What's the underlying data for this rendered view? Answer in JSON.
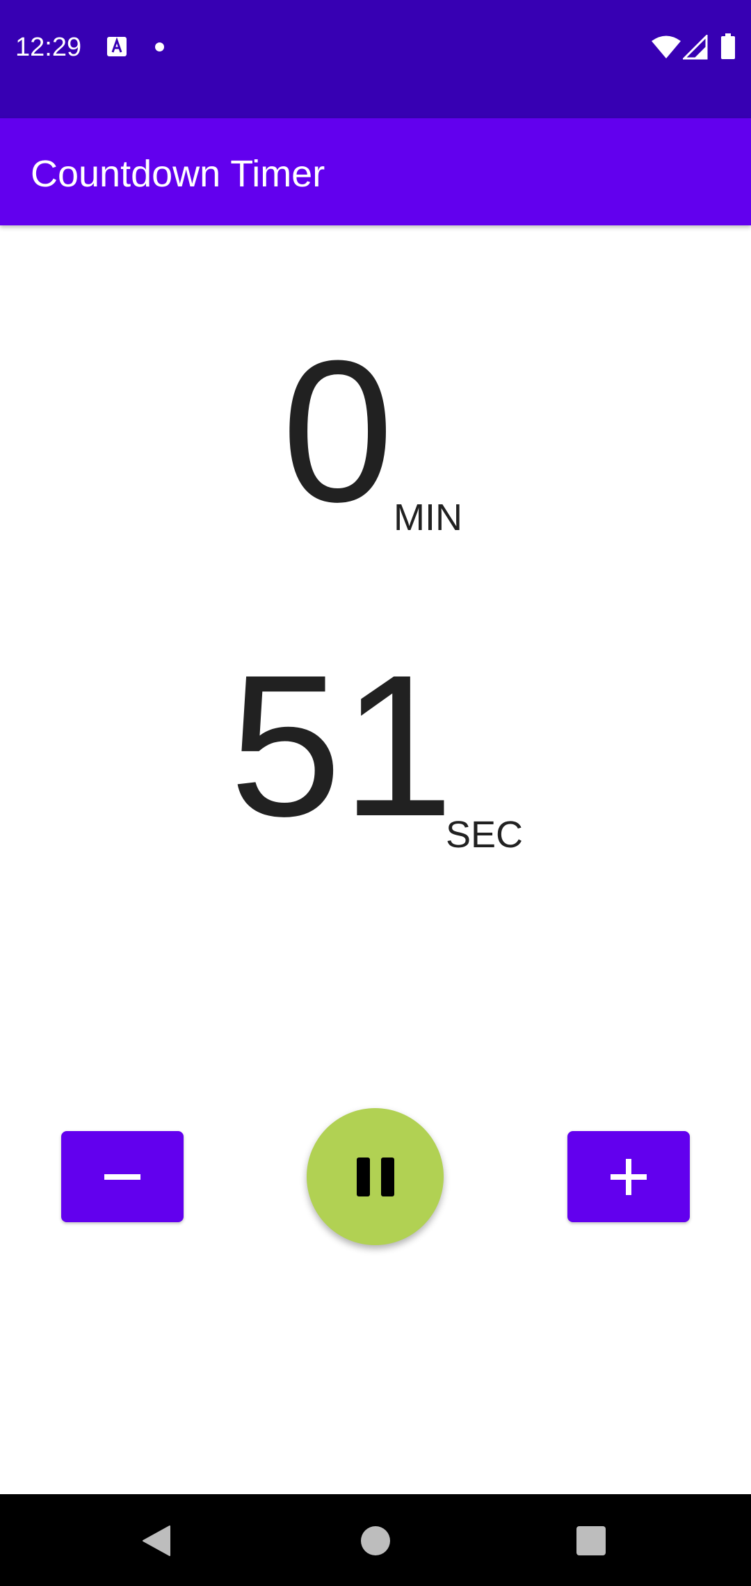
{
  "status_bar": {
    "time": "12:29",
    "icons": [
      "text-a-notification-icon",
      "notification-dot-icon",
      "wifi-icon",
      "cell-signal-icon",
      "battery-icon"
    ],
    "background_color": "#3700b3"
  },
  "app_bar": {
    "title": "Countdown Timer",
    "background_color": "#6200ee"
  },
  "timer": {
    "minutes": "0",
    "minutes_unit": "MIN",
    "seconds": "51",
    "seconds_unit": "SEC"
  },
  "controls": {
    "decrement_icon": "minus-icon",
    "play_pause_icon": "pause-icon",
    "increment_icon": "plus-icon",
    "button_color": "#6200ee",
    "play_pause_color": "#b1d153"
  },
  "nav_bar": {
    "icons": [
      "back-icon",
      "home-icon",
      "recents-icon"
    ]
  }
}
